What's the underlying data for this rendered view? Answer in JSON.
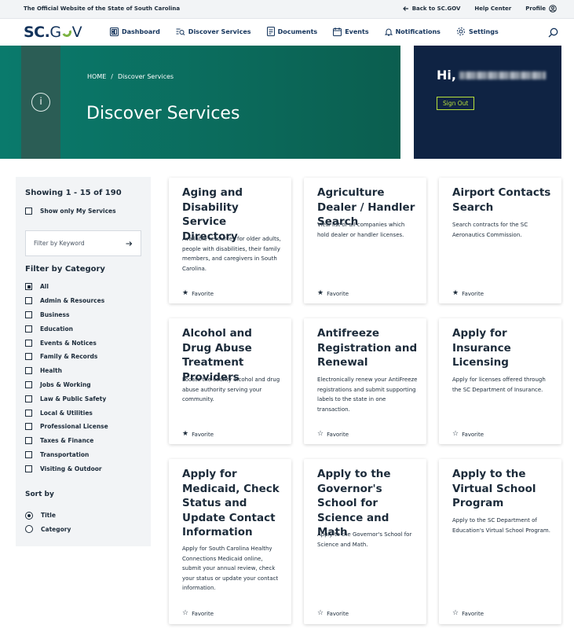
{
  "utility_bar": {
    "official_text": "The Official Website of the State of South Carolina",
    "back_link": "Back to SC.GOV",
    "help_center": "Help Center",
    "profile": "Profile"
  },
  "nav": {
    "logo_main": "SC",
    "logo_dot": ".",
    "logo_g": "G",
    "logo_v": "V",
    "items": [
      "Dashboard",
      "Discover Services",
      "Documents",
      "Events",
      "Notifications",
      "Settings"
    ]
  },
  "hero": {
    "breadcrumb_home": "HOME",
    "breadcrumb_sep": "/",
    "breadcrumb_current": "Discover Services",
    "title": "Discover Services",
    "info_glyph": "i"
  },
  "greeting": {
    "prefix": "Hi,",
    "signout": "Sign Out"
  },
  "sidebar": {
    "showing": "Showing 1 - 15 of 190",
    "only_my_services": "Show only My Services",
    "keyword_placeholder": "Filter by Keyword",
    "filter_heading": "Filter by Category",
    "categories": [
      {
        "label": "All",
        "checked": true
      },
      {
        "label": "Admin & Resources",
        "checked": false
      },
      {
        "label": "Business",
        "checked": false
      },
      {
        "label": "Education",
        "checked": false
      },
      {
        "label": "Events & Notices",
        "checked": false
      },
      {
        "label": "Family & Records",
        "checked": false
      },
      {
        "label": "Health",
        "checked": false
      },
      {
        "label": "Jobs & Working",
        "checked": false
      },
      {
        "label": "Law & Public Safety",
        "checked": false
      },
      {
        "label": "Local & Utilities",
        "checked": false
      },
      {
        "label": "Professional License",
        "checked": false
      },
      {
        "label": "Taxes & Finance",
        "checked": false
      },
      {
        "label": "Transportation",
        "checked": false
      },
      {
        "label": "Visiting & Outdoor",
        "checked": false
      }
    ],
    "sort_heading": "Sort by",
    "sort_options": [
      {
        "label": "Title",
        "selected": true
      },
      {
        "label": "Category",
        "selected": false
      }
    ]
  },
  "cards": [
    {
      "title": "Aging and Disability Service Directory",
      "desc": "Available resources for older adults, people with disabilities, their family members, and caregivers in South Carolina.",
      "fav_label": "Favorite",
      "favorited": true
    },
    {
      "title": "Agriculture Dealer / Handler Search",
      "desc": "View list of all companies which hold dealer or handler licenses.",
      "fav_label": "Favorite",
      "favorited": true
    },
    {
      "title": "Airport Contacts Search",
      "desc": "Search contracts for the SC Aeronautics Commission.",
      "fav_label": "Favorite",
      "favorited": true
    },
    {
      "title": "Alcohol and Drug Abuse Treatment Providers",
      "desc": "Locate the county alcohol and drug abuse authority serving your community.",
      "fav_label": "Favorite",
      "favorited": true
    },
    {
      "title": "Antifreeze Registration and Renewal",
      "desc": "Electronically renew your AntiFreeze registrations and submit supporting labels to the state in one transaction.",
      "fav_label": "Favorite",
      "favorited": false
    },
    {
      "title": "Apply for Insurance Licensing",
      "desc": "Apply for licenses offered through the SC Department of Insurance.",
      "fav_label": "Favorite",
      "favorited": false
    },
    {
      "title": "Apply for Medicaid, Check Status and Update Contact Information",
      "desc": "Apply for South Carolina Healthy Connections Medicaid online, submit your annual review, check your status or update your contact information.",
      "fav_label": "Favorite",
      "favorited": false
    },
    {
      "title": "Apply to the Governor's School for Science and Math",
      "desc": "Apply to the Governor's School for Science and Math.",
      "fav_label": "Favorite",
      "favorited": false
    },
    {
      "title": "Apply to the Virtual School Program",
      "desc": "Apply to the SC Department of Education's Virtual School Program.",
      "fav_label": "Favorite",
      "favorited": false
    }
  ],
  "colors": {
    "navy": "#0f2343",
    "teal": "#0a7a6c",
    "accent_green": "#b9e23c",
    "text": "#1c2b3a"
  }
}
